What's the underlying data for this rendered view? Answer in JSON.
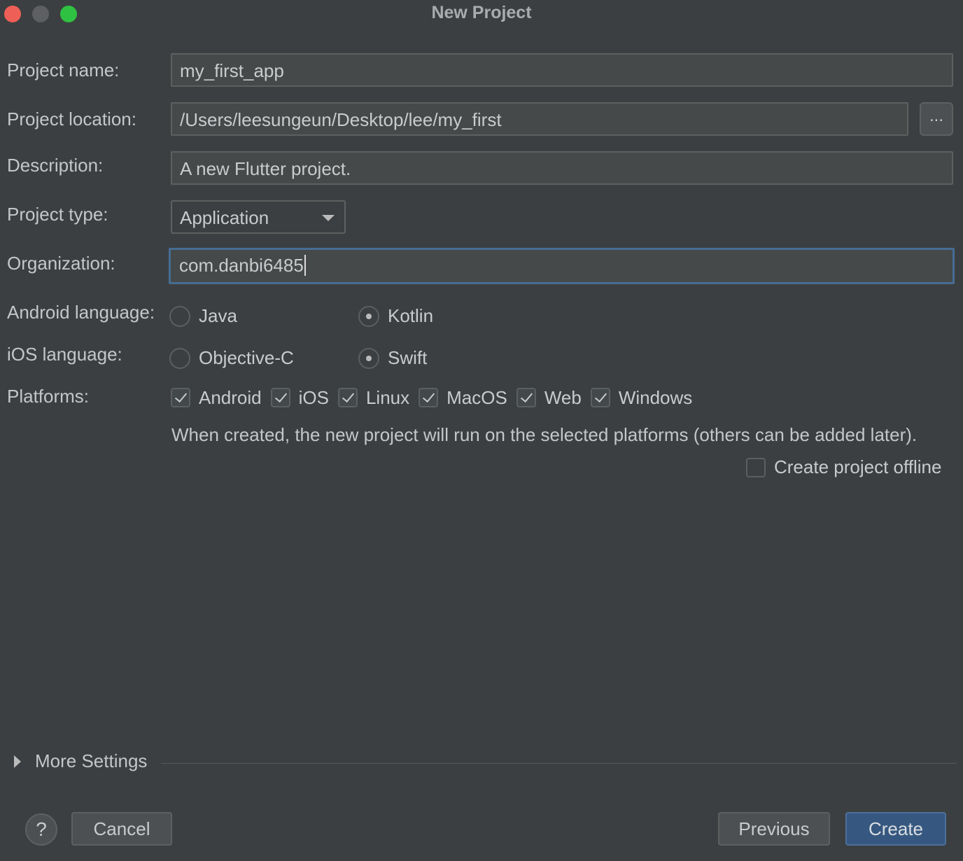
{
  "window": {
    "title": "New Project"
  },
  "form": {
    "project_name": {
      "label": "Project name:",
      "value": "my_first_app"
    },
    "project_location": {
      "label": "Project location:",
      "value": "/Users/leesungeun/Desktop/lee/my_first",
      "browse_label": "..."
    },
    "description": {
      "label": "Description:",
      "value": "A new Flutter project."
    },
    "project_type": {
      "label": "Project type:",
      "selected": "Application"
    },
    "organization": {
      "label": "Organization:",
      "value": "com.danbi6485"
    },
    "android_language": {
      "label": "Android language:",
      "options": [
        {
          "label": "Java",
          "selected": false
        },
        {
          "label": "Kotlin",
          "selected": true
        }
      ]
    },
    "ios_language": {
      "label": "iOS language:",
      "options": [
        {
          "label": "Objective-C",
          "selected": false
        },
        {
          "label": "Swift",
          "selected": true
        }
      ]
    },
    "platforms": {
      "label": "Platforms:",
      "items": [
        {
          "label": "Android",
          "checked": true
        },
        {
          "label": "iOS",
          "checked": true
        },
        {
          "label": "Linux",
          "checked": true
        },
        {
          "label": "MacOS",
          "checked": true
        },
        {
          "label": "Web",
          "checked": true
        },
        {
          "label": "Windows",
          "checked": true
        }
      ],
      "hint": "When created, the new project will run on the selected platforms (others can be added later)."
    },
    "offline": {
      "label": "Create project offline",
      "checked": false
    }
  },
  "more_settings": {
    "label": "More Settings"
  },
  "buttons": {
    "help": "?",
    "cancel": "Cancel",
    "previous": "Previous",
    "create": "Create"
  },
  "colors": {
    "background": "#3c3f41",
    "field": "#45494a",
    "focus_border": "#466d94",
    "primary_button": "#365880"
  }
}
